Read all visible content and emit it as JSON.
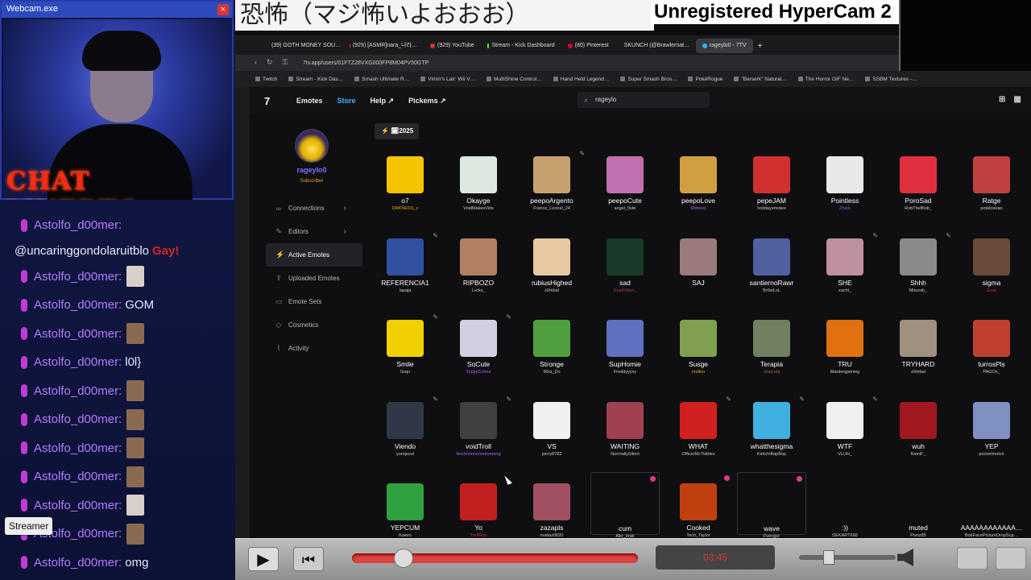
{
  "webcam": {
    "window_title": "Webcam.exe",
    "overlay_text": "CHAT MUERTO"
  },
  "chat": {
    "username": "Astolfo_d00mer:",
    "line2": "@uncaringgondolaruitblo",
    "line2_extra": "Gay!",
    "messages": [
      {
        "text": "",
        "emote": "w"
      },
      {
        "text": "GOM",
        "emote": ""
      },
      {
        "text": "",
        "emote": "b"
      },
      {
        "text": "l0l}",
        "emote": ""
      },
      {
        "text": "",
        "emote": "b"
      },
      {
        "text": "",
        "emote": "b"
      },
      {
        "text": "",
        "emote": "b"
      },
      {
        "text": "",
        "emote": "b"
      },
      {
        "text": "",
        "emote": "w"
      },
      {
        "text": "",
        "emote": "b"
      },
      {
        "text": "omg",
        "emote": ""
      }
    ],
    "streamer_tag": "Streamer"
  },
  "banner": {
    "japanese": "恐怖（マジ怖いよおおお）",
    "hypercam": "Unregistered HyperCam 2"
  },
  "browser": {
    "tabs": [
      {
        "label": "(39) GOTH MONEY SOU…",
        "color": "#e03030"
      },
      {
        "label": "(929) [ASMR]nara_나라…",
        "color": "#e03030"
      },
      {
        "label": "(929) YouTube",
        "color": "#e03030"
      },
      {
        "label": "Stream - Kick Dashboard",
        "color": "#53fc18"
      },
      {
        "label": "(80) Pinterest",
        "color": "#e60023"
      },
      {
        "label": "SKUNCH (@Brawlernat…",
        "color": "#ffffff"
      },
      {
        "label": "rageylo0 - 7TV",
        "color": "#29b6f6"
      }
    ],
    "url": "7tv.app/users/01FTZ28VXG000FP8M04PV50GTP",
    "bookmarks": [
      "Twitch",
      "Stream - Kick Das…",
      "Smash Ultimate R…",
      "Vimm's Lair: Wii V…",
      "MultiShine Control…",
      "Hand Held Legend…",
      "Super Smash Bros…",
      "PokéRogue",
      "\"Berserk\" Natural…",
      "The Horror GIF Ne…",
      "SSBM Textures -…"
    ]
  },
  "nav": {
    "logo": "7",
    "items": [
      "Emotes",
      "Store",
      "Help ↗",
      "Pickems ↗"
    ],
    "search_value": "rageylo"
  },
  "profile": {
    "name": "rageylo0",
    "badge": "Subscriber",
    "menu": [
      {
        "label": "Connections",
        "icon": "∞",
        "chevron": "›"
      },
      {
        "label": "Editors",
        "icon": "✎",
        "chevron": "›"
      },
      {
        "label": "Active Emotes",
        "icon": "⚡",
        "chevron": ""
      },
      {
        "label": "Uploaded Emotes",
        "icon": "⇪",
        "chevron": ""
      },
      {
        "label": "Emote Sets",
        "icon": "▭",
        "chevron": ""
      },
      {
        "label": "Cosmetics",
        "icon": "◇",
        "chevron": ""
      },
      {
        "label": "Activity",
        "icon": "⌇",
        "chevron": ""
      }
    ]
  },
  "year_filter": "⚡ 🗓2025",
  "emotes": [
    {
      "name": "o7",
      "author": "DRKNESS_x",
      "color": "#f5c400",
      "author_color": "#f0a000"
    },
    {
      "name": "Okayge",
      "author": "VoidMakesVids",
      "color": "#dfe8e0",
      "author_color": "#ccc"
    },
    {
      "name": "peepoArgento",
      "author": "Franco_Leonel_24",
      "color": "#c8a070",
      "author_color": "#ccc"
    },
    {
      "name": "peepoCute",
      "author": "angel_flute",
      "color": "#c070b0",
      "author_color": "#ccc"
    },
    {
      "name": "peepoLove",
      "author": "Shmovy",
      "color": "#d0a040",
      "author_color": "#b060ff"
    },
    {
      "name": "pepeJAM",
      "author": "holidayemotes",
      "color": "#d03030",
      "author_color": "#ccc"
    },
    {
      "name": "Pointless",
      "author": "Zhark",
      "color": "#e8e8e8",
      "author_color": "#5a6adf"
    },
    {
      "name": "PoroSad",
      "author": "RobTheBlob_",
      "color": "#e03040",
      "author_color": "#ccc"
    },
    {
      "name": "Ratge",
      "author": "potatosean",
      "color": "#c04040",
      "author_color": "#ccc"
    },
    {
      "name": "REFERENCIA1",
      "author": "lapaja",
      "color": "#3050a0",
      "author_color": "#ccc"
    },
    {
      "name": "RIPBOZO",
      "author": "Lvcks_",
      "color": "#b08060",
      "author_color": "#ccc"
    },
    {
      "name": "rubiusHighed",
      "author": "z0mbal",
      "color": "#e8c8a0",
      "author_color": "#ccc"
    },
    {
      "name": "sad",
      "author": "DeathWen_",
      "color": "#1a3a2a",
      "author_color": "#a04040"
    },
    {
      "name": "SAJ",
      "author": "",
      "color": "#9a7a7a",
      "author_color": "#ccc"
    },
    {
      "name": "santiernoRawr",
      "author": "Br0wLoL",
      "color": "#5060a0",
      "author_color": "#ccc"
    },
    {
      "name": "SHE",
      "author": "zachl_",
      "color": "#c090a0",
      "author_color": "#ccc"
    },
    {
      "name": "Shhh",
      "author": "Mouzah_",
      "color": "#8a8a8a",
      "author_color": "#ccc"
    },
    {
      "name": "sigma",
      "author": "Eron",
      "color": "#6a4a3a",
      "author_color": "#d03030"
    },
    {
      "name": "Smile",
      "author": "0zqu",
      "color": "#f0d000",
      "author_color": "#ccc"
    },
    {
      "name": "SoCute",
      "author": "TrippyColour",
      "color": "#d0d0e0",
      "author_color": "#b060ff"
    },
    {
      "name": "Stronge",
      "author": "90ra_Dn",
      "color": "#50a040",
      "author_color": "#ccc"
    },
    {
      "name": "SupHomie",
      "author": "Freddyyyxy",
      "color": "#6070c0",
      "author_color": "#ccc"
    },
    {
      "name": "Susge",
      "author": "mellen",
      "color": "#80a050",
      "author_color": "#f0a000"
    },
    {
      "name": "Terapia",
      "author": "chacrala",
      "color": "#708060",
      "author_color": "#b06040"
    },
    {
      "name": "TRU",
      "author": "Mardexgaming",
      "color": "#e07010",
      "author_color": "#ccc"
    },
    {
      "name": "TRYHARD",
      "author": "z0mbal",
      "color": "#a09080",
      "author_color": "#ccc"
    },
    {
      "name": "turrosPls",
      "author": "PAGOx_",
      "color": "#c04030",
      "author_color": "#ccc"
    },
    {
      "name": "Viendo",
      "author": "yunqsoul",
      "color": "#303848",
      "author_color": "#ccc"
    },
    {
      "name": "voidTroll",
      "author": "hnnnnnnnnnnnnnnnng",
      "color": "#404040",
      "author_color": "#b060ff"
    },
    {
      "name": "VS",
      "author": "perry8782",
      "color": "#f0f0f0",
      "author_color": "#ccc"
    },
    {
      "name": "WAITING",
      "author": "NormallySilent",
      "color": "#a04050",
      "author_color": "#ccc"
    },
    {
      "name": "WHAT",
      "author": "OfficerMcTiddies",
      "color": "#d02020",
      "author_color": "#ccc"
    },
    {
      "name": "whatthesigma",
      "author": "KimchiBapBop",
      "color": "#40b0e0",
      "author_color": "#ccc"
    },
    {
      "name": "WTF",
      "author": "VLUH_",
      "color": "#f0f0f0",
      "author_color": "#ccc"
    },
    {
      "name": "wuh",
      "author": "RainiF_",
      "color": "#a01820",
      "author_color": "#ccc"
    },
    {
      "name": "YEP",
      "author": "pocketmotch",
      "color": "#8090c0",
      "author_color": "#ccc"
    },
    {
      "name": "YEPCUM",
      "author": "Kaiers",
      "color": "#30a040",
      "author_color": "#ccc"
    },
    {
      "name": "Yo",
      "author": "TrollTom",
      "color": "#c02020",
      "author_color": "#d03030"
    },
    {
      "name": "zazapls",
      "author": "matiaz0820",
      "color": "#a05060",
      "author_color": "#ccc"
    },
    {
      "name": "cum",
      "author": "Alkr_krab",
      "color": "",
      "author_color": "#ccc"
    },
    {
      "name": "Cooked",
      "author": "Tech_Taylor",
      "color": "#c04010",
      "author_color": "#ccc"
    },
    {
      "name": "wave",
      "author": "Fvenger",
      "color": "",
      "author_color": "#ccc"
    },
    {
      "name": ":))",
      "author": "DEKART666",
      "color": "",
      "author_color": "#ccc"
    },
    {
      "name": "muted",
      "author": "Pwnz85",
      "color": "",
      "author_color": "#ccc"
    },
    {
      "name": "AAAAAAAAAAAA…",
      "author": "BobFacePictureDropSup…",
      "color": "",
      "author_color": "#ccc"
    }
  ],
  "media": {
    "time": "03:45"
  }
}
